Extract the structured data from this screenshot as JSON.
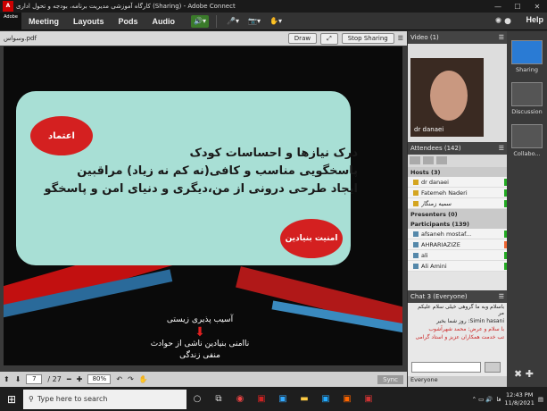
{
  "window": {
    "title": "کارگاه آموزشی مدیریت برنامه، بودجه و تحول اداری (Sharing) - Adobe Connect",
    "logo": "Adobe",
    "min": "—",
    "max": "☐",
    "close": "✕"
  },
  "menu": [
    "Meeting",
    "Layouts",
    "Pods",
    "Audio"
  ],
  "help": "Help",
  "share_pod": {
    "file": "وسواس.pdf",
    "draw": "Draw",
    "stop": "Stop Sharing"
  },
  "slide": {
    "badge1": "اعتماد",
    "badge2": "امنیت بنیادین",
    "line1": "درک نیازها و احساسات کودک",
    "line2": "پاسخگویی مناسب و کافی(نه کم نه زیاد) مراقبین",
    "line3": "ایجاد طرحی درونی از من،دیگری و دنیای امن و پاسخگو",
    "sub1": "آسیب پذیری زیستی",
    "sub2": "ناامنی بنیادین ناشی از حوادث",
    "sub3": "منفی زندگی"
  },
  "pager": {
    "page": "7",
    "total": "/ 27",
    "zoom": "80%",
    "sync": "Sync"
  },
  "video": {
    "title": "Video",
    "count": "(1)",
    "name": "dr danaei"
  },
  "attendees": {
    "title": "Attendees",
    "count": "(142)",
    "hosts": "Hosts (3)",
    "presenters": "Presenters (0)",
    "participants": "Participants (139)",
    "host_list": [
      "dr danaei",
      "Fatemeh Naderi",
      "سمیه زمنگار"
    ],
    "part_list": [
      "afsaneh mostaf...",
      "AHRARIAZIZE",
      "ali",
      "Ali Amini"
    ]
  },
  "chat": {
    "title": "Chat 3",
    "scope": "(Everyone)",
    "msgs": [
      "باسلام وبه ما گروهی خیلی سلام علیکم مر",
      "Simin hasani: روز شما بخیر",
      "با سلام و عرض: محمد شهرآشوب",
      "تب خدمت همکاران عزیز و استاد گرامی"
    ],
    "tab": "Everyone"
  },
  "layouts": [
    "Sharing",
    "Discussion",
    "Collabo..."
  ],
  "taskbar": {
    "search": "Type here to search",
    "time": "12:43 PM",
    "date": "11/8/2021",
    "lang": "فا"
  }
}
